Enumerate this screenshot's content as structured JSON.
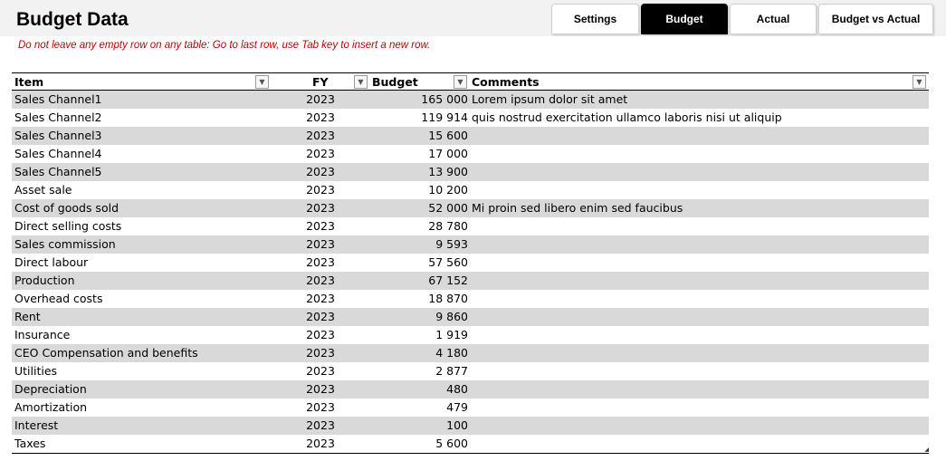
{
  "header": {
    "title": "Budget Data"
  },
  "tabs": [
    {
      "label": "Settings",
      "active": false
    },
    {
      "label": "Budget",
      "active": true
    },
    {
      "label": "Actual",
      "active": false
    },
    {
      "label": "Budget vs Actual",
      "active": false
    }
  ],
  "notice": "Do not leave any empty row on any table: Go to last row, use Tab key to insert a new row.",
  "table": {
    "columns": [
      "Item",
      "FY",
      "Budget",
      "Comments"
    ],
    "filter_icon": "dropdown-arrow-icon",
    "rows": [
      {
        "item": "Sales Channel1",
        "fy": "2023",
        "budget": "165 000",
        "comments": "Lorem ipsum dolor sit amet"
      },
      {
        "item": "Sales Channel2",
        "fy": "2023",
        "budget": "119 914",
        "comments": "quis nostrud exercitation ullamco laboris nisi ut aliquip"
      },
      {
        "item": "Sales Channel3",
        "fy": "2023",
        "budget": "15 600",
        "comments": ""
      },
      {
        "item": "Sales Channel4",
        "fy": "2023",
        "budget": "17 000",
        "comments": ""
      },
      {
        "item": "Sales Channel5",
        "fy": "2023",
        "budget": "13 900",
        "comments": ""
      },
      {
        "item": "Asset sale",
        "fy": "2023",
        "budget": "10 200",
        "comments": ""
      },
      {
        "item": "Cost of goods sold",
        "fy": "2023",
        "budget": "52 000",
        "comments": "Mi proin sed libero enim sed faucibus"
      },
      {
        "item": "Direct selling costs",
        "fy": "2023",
        "budget": "28 780",
        "comments": ""
      },
      {
        "item": "Sales commission",
        "fy": "2023",
        "budget": "9 593",
        "comments": ""
      },
      {
        "item": "Direct labour",
        "fy": "2023",
        "budget": "57 560",
        "comments": ""
      },
      {
        "item": "Production",
        "fy": "2023",
        "budget": "67 152",
        "comments": ""
      },
      {
        "item": "Overhead costs",
        "fy": "2023",
        "budget": "18 870",
        "comments": ""
      },
      {
        "item": "Rent",
        "fy": "2023",
        "budget": "9 860",
        "comments": ""
      },
      {
        "item": "Insurance",
        "fy": "2023",
        "budget": "1 919",
        "comments": ""
      },
      {
        "item": "CEO Compensation and benefits",
        "fy": "2023",
        "budget": "4 180",
        "comments": ""
      },
      {
        "item": "Utilities",
        "fy": "2023",
        "budget": "2 877",
        "comments": ""
      },
      {
        "item": "Depreciation",
        "fy": "2023",
        "budget": "480",
        "comments": ""
      },
      {
        "item": "Amortization",
        "fy": "2023",
        "budget": "479",
        "comments": ""
      },
      {
        "item": "Interest",
        "fy": "2023",
        "budget": "100",
        "comments": ""
      },
      {
        "item": "Taxes",
        "fy": "2023",
        "budget": "5 600",
        "comments": ""
      }
    ]
  }
}
